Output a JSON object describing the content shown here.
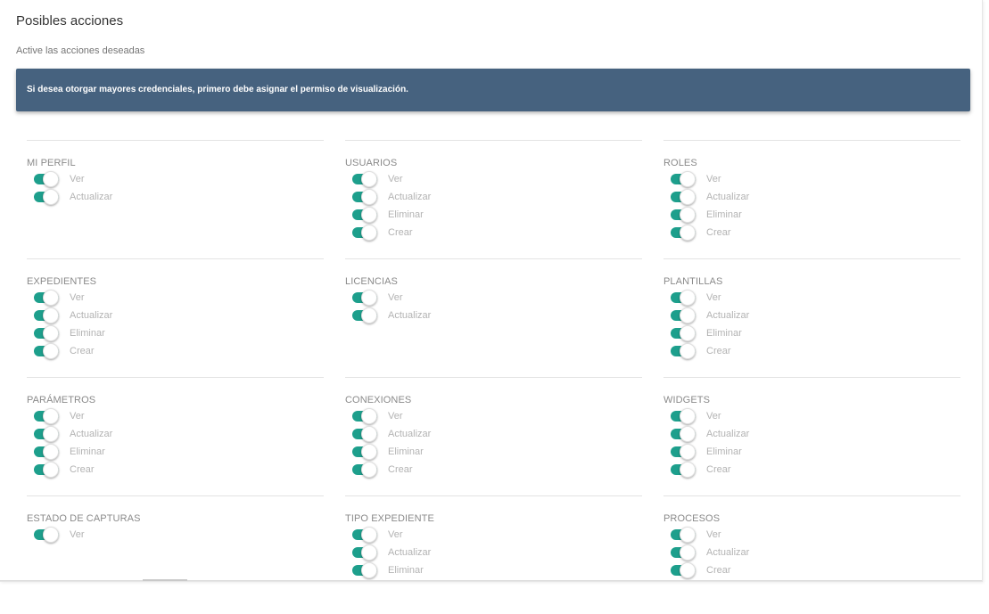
{
  "header": {
    "title": "Posibles acciones",
    "subtitle": "Active las acciones deseadas"
  },
  "banner": {
    "text": "Si desea otorgar mayores credenciales, primero debe asignar el permiso de visualización.",
    "color": "#46627f"
  },
  "toggle_color": "#1d9f8c",
  "sections": [
    {
      "title": "MI PERFIL",
      "permissions": [
        {
          "label": "Ver",
          "enabled": true
        },
        {
          "label": "Actualizar",
          "enabled": true
        }
      ]
    },
    {
      "title": "USUARIOS",
      "permissions": [
        {
          "label": "Ver",
          "enabled": true
        },
        {
          "label": "Actualizar",
          "enabled": true
        },
        {
          "label": "Eliminar",
          "enabled": true
        },
        {
          "label": "Crear",
          "enabled": true
        }
      ]
    },
    {
      "title": "ROLES",
      "permissions": [
        {
          "label": "Ver",
          "enabled": true
        },
        {
          "label": "Actualizar",
          "enabled": true
        },
        {
          "label": "Eliminar",
          "enabled": true
        },
        {
          "label": "Crear",
          "enabled": true
        }
      ]
    },
    {
      "title": "EXPEDIENTES",
      "permissions": [
        {
          "label": "Ver",
          "enabled": true
        },
        {
          "label": "Actualizar",
          "enabled": true
        },
        {
          "label": "Eliminar",
          "enabled": true
        },
        {
          "label": "Crear",
          "enabled": true
        }
      ]
    },
    {
      "title": "LICENCIAS",
      "permissions": [
        {
          "label": "Ver",
          "enabled": true
        },
        {
          "label": "Actualizar",
          "enabled": true
        }
      ]
    },
    {
      "title": "PLANTILLAS",
      "permissions": [
        {
          "label": "Ver",
          "enabled": true
        },
        {
          "label": "Actualizar",
          "enabled": true
        },
        {
          "label": "Eliminar",
          "enabled": true
        },
        {
          "label": "Crear",
          "enabled": true
        }
      ]
    },
    {
      "title": "PARÁMETROS",
      "permissions": [
        {
          "label": "Ver",
          "enabled": true
        },
        {
          "label": "Actualizar",
          "enabled": true
        },
        {
          "label": "Eliminar",
          "enabled": true
        },
        {
          "label": "Crear",
          "enabled": true
        }
      ]
    },
    {
      "title": "CONEXIONES",
      "permissions": [
        {
          "label": "Ver",
          "enabled": true
        },
        {
          "label": "Actualizar",
          "enabled": true
        },
        {
          "label": "Eliminar",
          "enabled": true
        },
        {
          "label": "Crear",
          "enabled": true
        }
      ]
    },
    {
      "title": "WIDGETS",
      "permissions": [
        {
          "label": "Ver",
          "enabled": true
        },
        {
          "label": "Actualizar",
          "enabled": true
        },
        {
          "label": "Eliminar",
          "enabled": true
        },
        {
          "label": "Crear",
          "enabled": true
        }
      ]
    },
    {
      "title": "ESTADO DE CAPTURAS",
      "permissions": [
        {
          "label": "Ver",
          "enabled": true
        }
      ]
    },
    {
      "title": "TIPO EXPEDIENTE",
      "permissions": [
        {
          "label": "Ver",
          "enabled": true
        },
        {
          "label": "Actualizar",
          "enabled": true
        },
        {
          "label": "Eliminar",
          "enabled": true
        }
      ]
    },
    {
      "title": "PROCESOS",
      "permissions": [
        {
          "label": "Ver",
          "enabled": true
        },
        {
          "label": "Actualizar",
          "enabled": true
        },
        {
          "label": "Crear",
          "enabled": true
        }
      ]
    }
  ]
}
